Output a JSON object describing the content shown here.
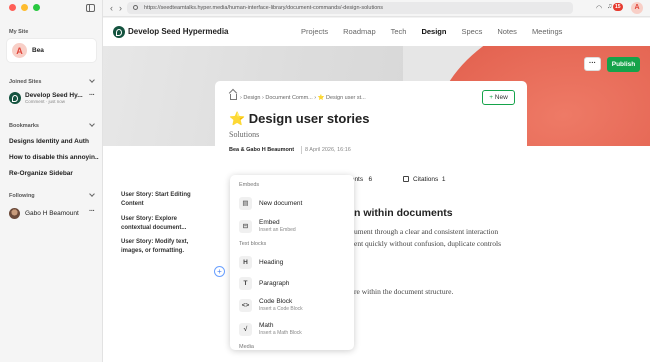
{
  "browser": {
    "url": "https://seedteamtalks.hyper.media/human-interface-library/document-commands/-design-solutions",
    "notification_count": "15",
    "avatar_letter": "A"
  },
  "sidebar": {
    "my_site_label": "My Site",
    "my_site_name": "Bea",
    "my_site_letter": "A",
    "joined_label": "Joined Sites",
    "joined_site": {
      "title": "Develop Seed Hy...",
      "subtitle": "Comment · just now"
    },
    "bookmarks_label": "Bookmarks",
    "bookmarks": [
      "Designs Identity and Auth",
      "How to disable this annoyin...",
      "Re-Organize Sidebar"
    ],
    "following_label": "Following",
    "following": [
      "Gabo H Beamount"
    ]
  },
  "header": {
    "site_title": "Develop Seed Hypermedia",
    "menu": [
      {
        "label": "Projects",
        "active": false
      },
      {
        "label": "Roadmap",
        "active": false
      },
      {
        "label": "Tech",
        "active": false
      },
      {
        "label": "Design",
        "active": true
      },
      {
        "label": "Specs",
        "active": false
      },
      {
        "label": "Notes",
        "active": false
      },
      {
        "label": "Meetings",
        "active": false
      }
    ],
    "more_label": "···",
    "publish_label": "Publish"
  },
  "document": {
    "breadcrumb": "› Design › Document Comm... › ⭐ Design user st...",
    "new_label": "New",
    "title": "⭐ Design user stories",
    "subtitle": "Solutions",
    "authors": "Bea & Gabo H Beaumont",
    "date": "8 April 2026, 16:16",
    "comments_label": "mments",
    "comments_count": "6",
    "citations_label": "Citations",
    "citations_count": "1",
    "heading": "n within documents",
    "para_line1": "ument through a clear and consistent interaction",
    "para_line2": "ent quickly without confusion, duplicate controls",
    "para_line3": "re within the document structure."
  },
  "toc": [
    "User Story: Start Editing Content",
    "User Story: Explore contextual document...",
    "User Story: Modify text, images, or formatting."
  ],
  "slash_menu": {
    "groups": {
      "embeds": "Embeds",
      "text_blocks": "Text blocks",
      "media": "Media"
    },
    "items": {
      "new_document": {
        "title": "New document",
        "desc": ""
      },
      "embed": {
        "title": "Embed",
        "desc": "Insert an Embed"
      },
      "heading": {
        "title": "Heading",
        "desc": ""
      },
      "paragraph": {
        "title": "Paragraph",
        "desc": ""
      },
      "code_block": {
        "title": "Code Block",
        "desc": "Insert a Code Block"
      },
      "math": {
        "title": "Math",
        "desc": "Insert a Math Block"
      }
    }
  },
  "colors": {
    "accent": "#15a34a",
    "brand_dark": "#14533f",
    "cover_red": "#e2604e",
    "danger": "#e63a2f"
  }
}
